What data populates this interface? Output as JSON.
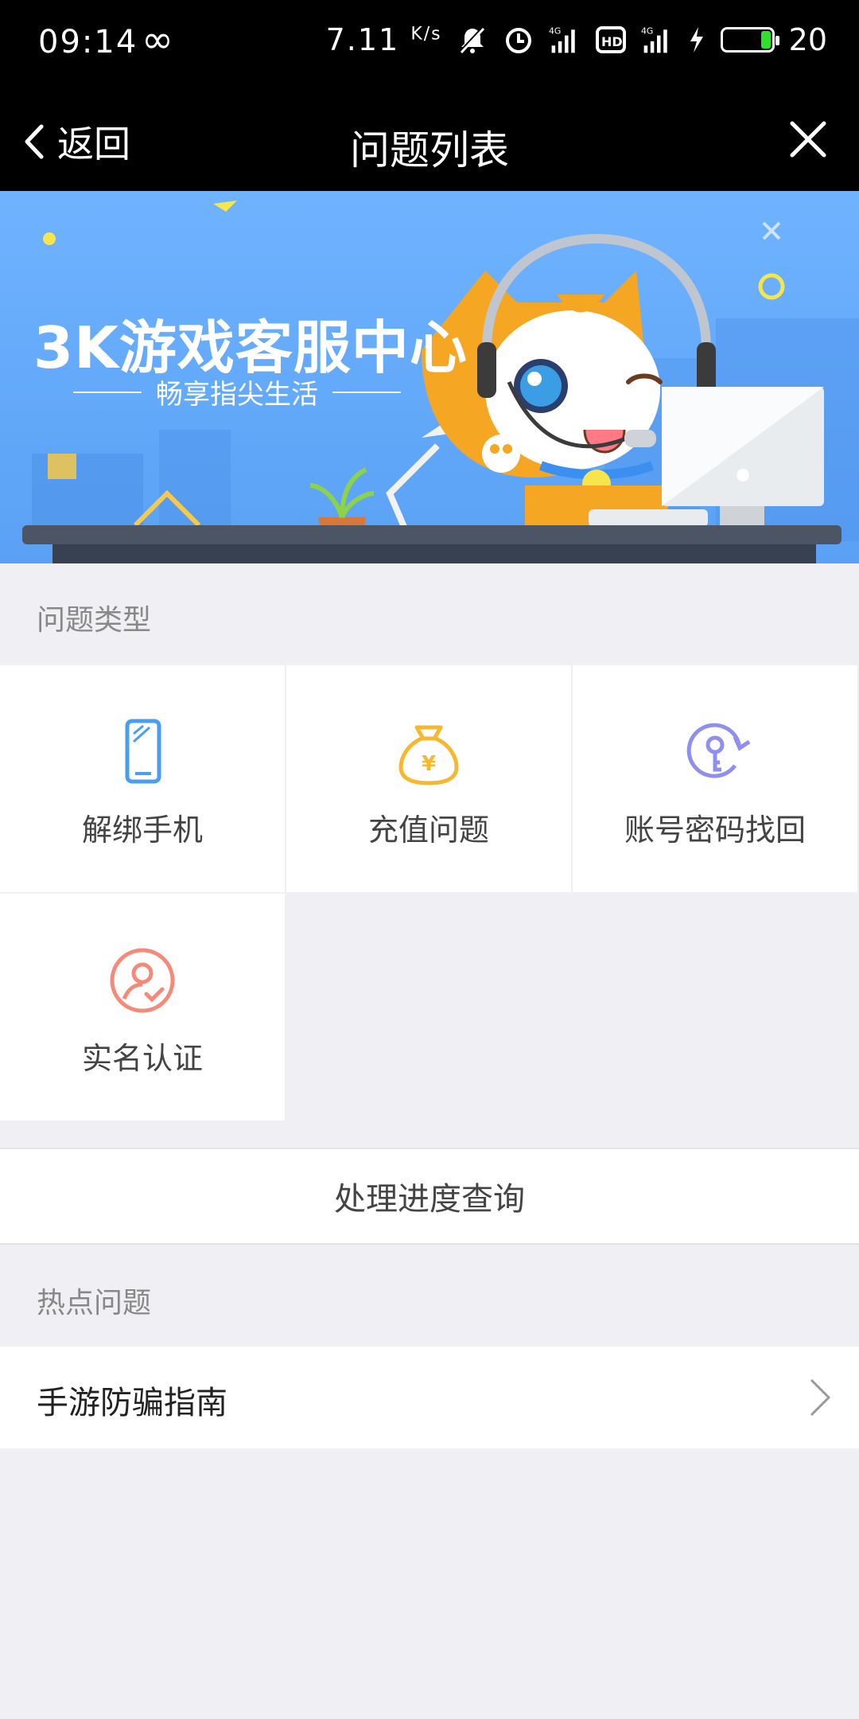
{
  "status_bar": {
    "time": "09:14",
    "speed": "7.11",
    "speed_unit": "K/s",
    "battery_level": "20",
    "icons": [
      "infinity-icon",
      "muted-bell-icon",
      "alarm-icon",
      "signal-4g-icon",
      "hd-icon",
      "signal-4g-icon",
      "charging-icon",
      "battery-icon"
    ]
  },
  "nav": {
    "back_label": "返回",
    "title": "问题列表"
  },
  "banner": {
    "title": "3K游戏客服中心",
    "subtitle": "畅享指尖生活"
  },
  "problem_types": {
    "label": "问题类型",
    "items": [
      {
        "label": "解绑手机",
        "icon": "phone-icon",
        "color": "#4a9ef0"
      },
      {
        "label": "充值问题",
        "icon": "money-bag-icon",
        "color": "#f5b82e"
      },
      {
        "label": "账号密码找回",
        "icon": "key-refresh-icon",
        "color": "#8f8ff0"
      },
      {
        "label": "实名认证",
        "icon": "user-verify-icon",
        "color": "#f58a78"
      }
    ]
  },
  "progress": {
    "label": "处理进度查询"
  },
  "hot": {
    "label": "热点问题",
    "items": [
      {
        "label": "手游防骗指南"
      }
    ]
  },
  "colors": {
    "banner_bg": "#5aa1f5",
    "page_bg": "#efeff4",
    "bar_bg": "#000000"
  }
}
